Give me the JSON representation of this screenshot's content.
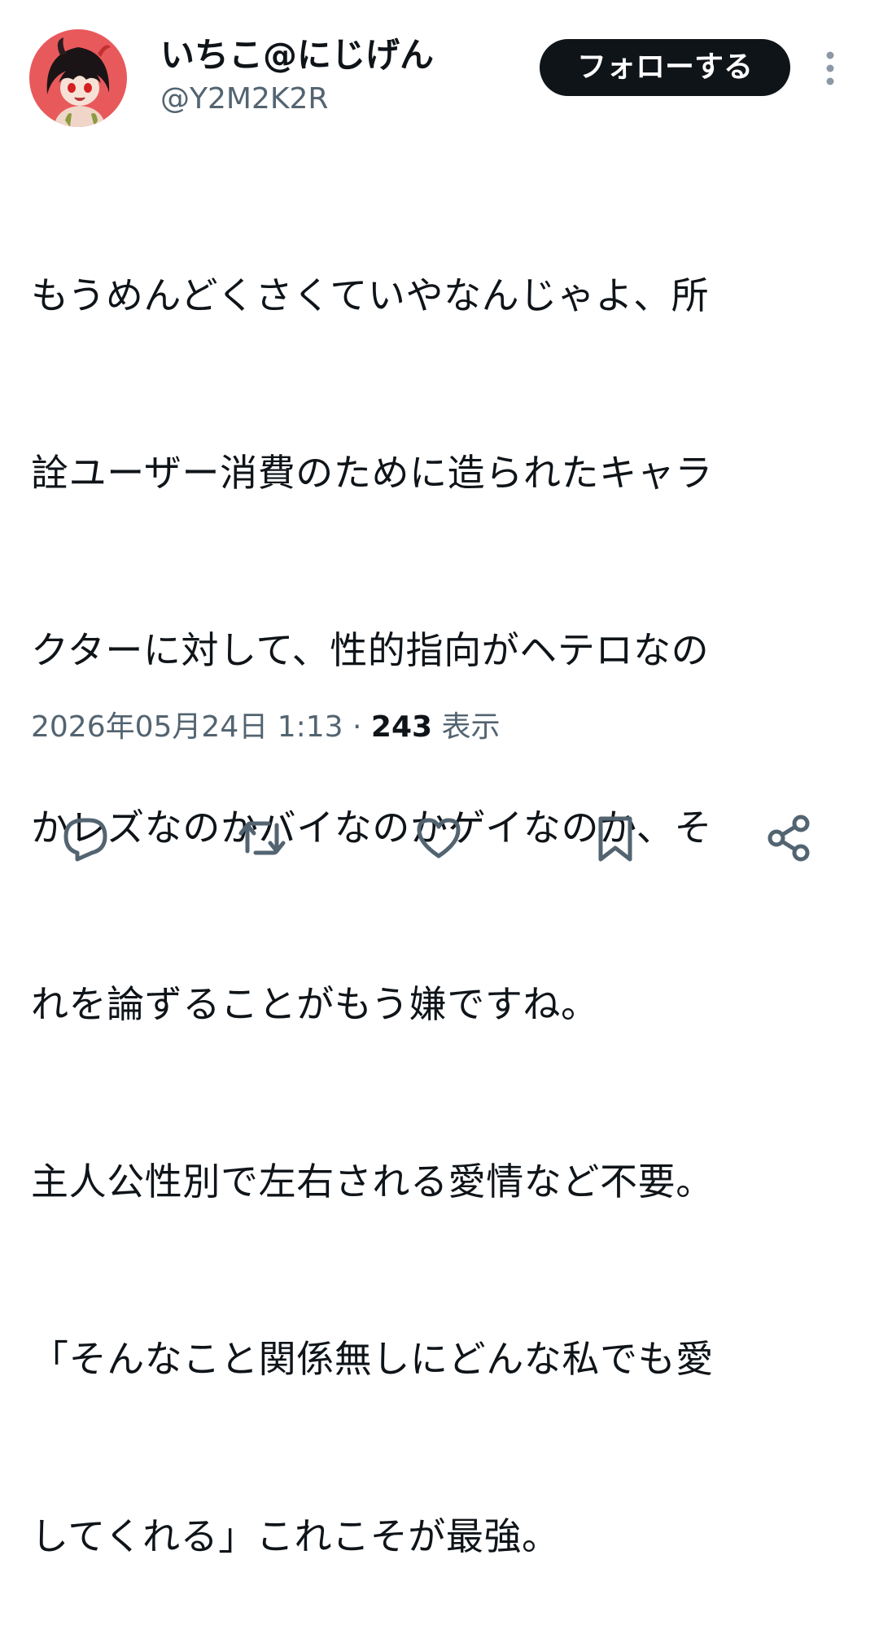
{
  "author": {
    "display_name": "いちこ@にじげん",
    "handle": "@Y2M2K2R",
    "avatar_icon": "avatar-image"
  },
  "follow_button": {
    "label": "フォローする"
  },
  "more_menu": {
    "icon": "more-vertical-icon"
  },
  "tweet": {
    "lines": [
      "もうめんどくさくていやなんじゃよ、所",
      "詮ユーザー消費のために造られたキャラ",
      "クターに対して、性的指向がヘテロなの",
      "かレズなのかバイなのかゲイなのか、そ",
      "れを論ずることがもう嫌ですね。",
      "主人公性別で左右される愛情など不要。",
      "「そんなこと関係無しにどんな私でも愛",
      "してくれる」これこそが最強。"
    ]
  },
  "meta": {
    "date": "2026年05月24日",
    "time": "1:13",
    "separator": "·",
    "views_count": "243",
    "views_label": "表示"
  },
  "actions": [
    {
      "name": "reply",
      "icon": "reply-icon"
    },
    {
      "name": "repost",
      "icon": "repost-icon"
    },
    {
      "name": "like",
      "icon": "like-icon"
    },
    {
      "name": "bookmark",
      "icon": "bookmark-icon"
    },
    {
      "name": "share",
      "icon": "share-icon"
    }
  ],
  "colors": {
    "text_primary": "#0f1419",
    "text_secondary": "#536471",
    "icon_gray": "#536471",
    "button_bg": "#0f1419",
    "avatar_bg": "#e8595c"
  }
}
